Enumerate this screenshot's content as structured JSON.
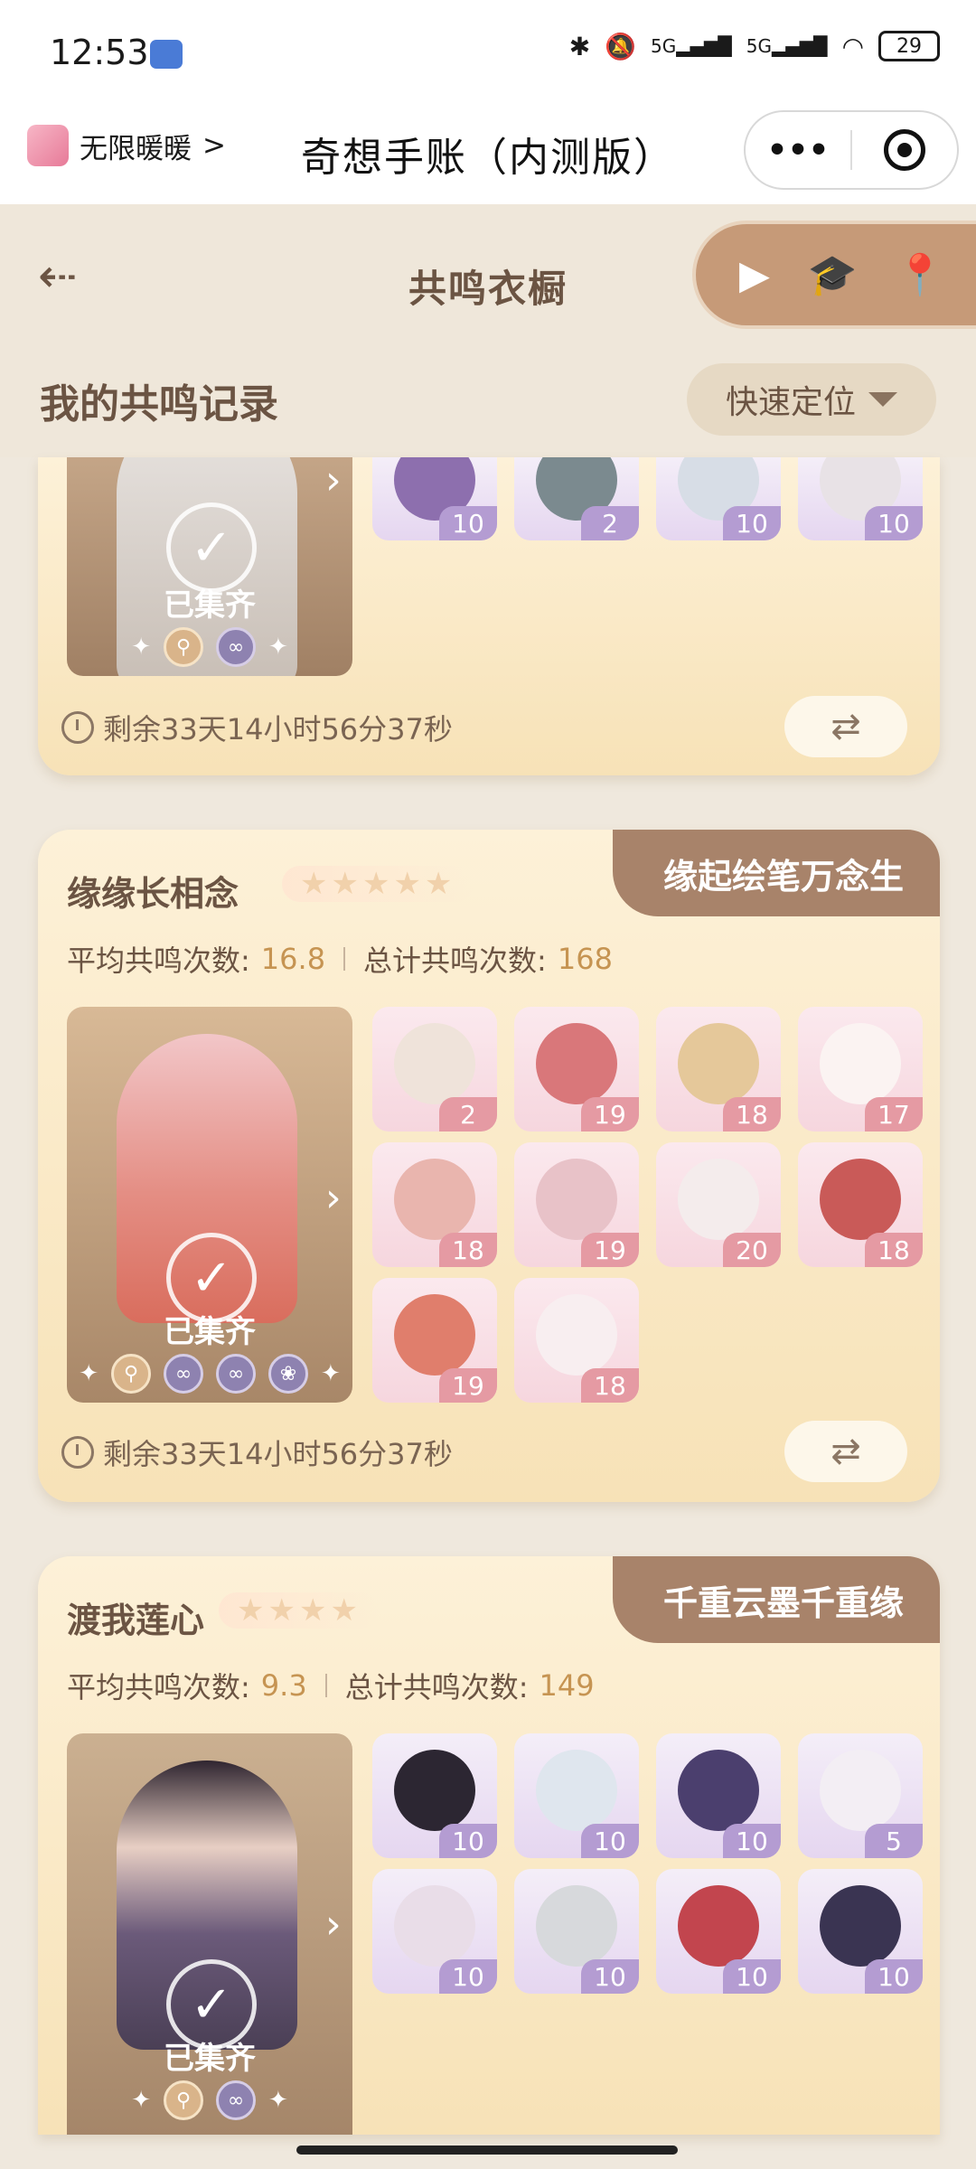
{
  "status_bar": {
    "time": "12:53",
    "icons": [
      "bluetooth-icon",
      "mute-icon",
      "signal-5g-icon",
      "signal-5g-icon",
      "wifi-icon"
    ],
    "network_labels": [
      "5G",
      "5G"
    ],
    "battery": "29"
  },
  "miniprogram": {
    "left_label": "无限暖暖",
    "left_chevron": ">",
    "title": "奇想手账（内测版）",
    "menu_dots": "•••"
  },
  "header": {
    "back_glyph": "⇠",
    "title": "共鸣衣橱",
    "section_title": "我的共鸣记录",
    "locate_label": "快速定位"
  },
  "cards": [
    {
      "collected_label": "已集齐",
      "items": [
        {
          "count": "10",
          "tone": "purple"
        },
        {
          "count": "2",
          "tone": "purple"
        },
        {
          "count": "10",
          "tone": "purple"
        },
        {
          "count": "10",
          "tone": "purple"
        }
      ],
      "remaining": "剩余33天14小时56分37秒"
    },
    {
      "name": "缘缘长相念",
      "stars": "★★★★★",
      "tag": "缘起绘笔万念生",
      "avg_label": "平均共鸣次数:",
      "avg_value": "16.8",
      "total_label": "总计共鸣次数:",
      "total_value": "168",
      "collected_label": "已集齐",
      "items": [
        {
          "count": "2",
          "tone": "pink"
        },
        {
          "count": "19",
          "tone": "pink"
        },
        {
          "count": "18",
          "tone": "pink"
        },
        {
          "count": "17",
          "tone": "pink"
        },
        {
          "count": "18",
          "tone": "pink"
        },
        {
          "count": "19",
          "tone": "pink"
        },
        {
          "count": "20",
          "tone": "pink"
        },
        {
          "count": "18",
          "tone": "pink"
        },
        {
          "count": "19",
          "tone": "pink"
        },
        {
          "count": "18",
          "tone": "pink"
        }
      ],
      "remaining": "剩余33天14小时56分37秒"
    },
    {
      "name": "渡我莲心",
      "stars": "★★★★",
      "tag": "千重云墨千重缘",
      "avg_label": "平均共鸣次数:",
      "avg_value": "9.3",
      "total_label": "总计共鸣次数:",
      "total_value": "149",
      "collected_label": "已集齐",
      "items": [
        {
          "count": "10",
          "tone": "purple"
        },
        {
          "count": "10",
          "tone": "purple"
        },
        {
          "count": "10",
          "tone": "purple"
        },
        {
          "count": "5",
          "tone": "purple"
        },
        {
          "count": "10",
          "tone": "purple"
        },
        {
          "count": "10",
          "tone": "purple"
        },
        {
          "count": "10",
          "tone": "purple"
        },
        {
          "count": "10",
          "tone": "purple"
        }
      ]
    }
  ],
  "colors": {
    "page_bg": "#efe8dd",
    "card_bg": "#f7e2b7",
    "tag_bg": "#a8836a",
    "accent_number": "#c69452",
    "pink_badge": "#e59aa3",
    "purple_badge": "#b49cd2"
  }
}
